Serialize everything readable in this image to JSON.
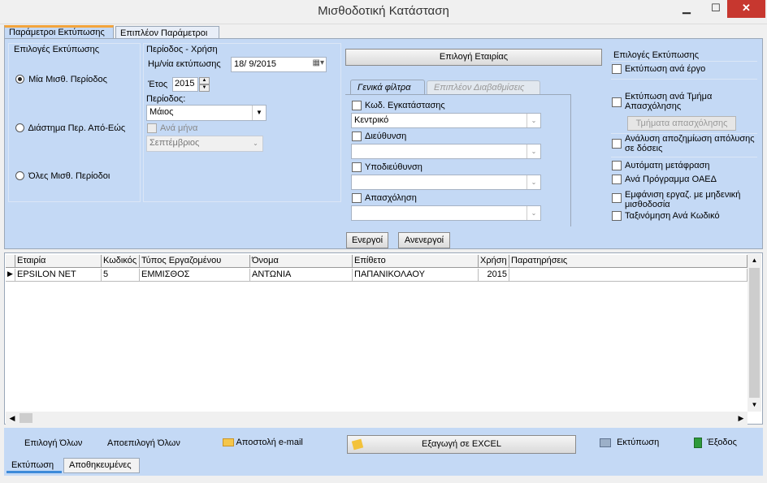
{
  "window": {
    "title": "Μισθοδοτική Κατάσταση",
    "minimize": "▁",
    "maximize": "☐",
    "close": "✕"
  },
  "top_tabs": [
    "Παράμετροι Εκτύπωσης",
    "Επιπλέον Παράμετροι"
  ],
  "print_options_group": {
    "title": "Επιλογές Εκτύπωσης",
    "radios": [
      {
        "label": "Μία Μισθ. Περίοδος",
        "selected": true
      },
      {
        "label": "Διάστημα Περ.  Από-Εώς",
        "selected": false
      },
      {
        "label": "Όλες Μισθ. Περίοδοι",
        "selected": false
      }
    ]
  },
  "period_group": {
    "title": "Περίοδος - Χρήση",
    "date_label": "Ημ/νία εκτύπωσης",
    "date_value": "18/  9/2015",
    "year_label": "Έτος",
    "year_value": "2015",
    "period_label": "Περίοδος:",
    "period_value": "Μάιος",
    "per_month_label": "Ανά μήνα",
    "month_value": "Σεπτέμβριος"
  },
  "company_button": "Επιλογή Εταιρίας",
  "filter_tabs": [
    "Γενικά φίλτρα",
    "Επιπλέον Διαβαθμίσεις"
  ],
  "filters": [
    {
      "label": "Κωδ. Εγκατάστασης",
      "value": "Κεντρικό"
    },
    {
      "label": "Διεύθυνση",
      "value": ""
    },
    {
      "label": "Υποδιεύθυνση",
      "value": ""
    },
    {
      "label": "Απασχόληση",
      "value": ""
    }
  ],
  "active_button": "Ενεργοί",
  "inactive_button": "Ανενεργοί",
  "right_options": {
    "title": "Επιλογές Εκτύπωσης",
    "items": [
      "Εκτύπωση ανά έργο",
      "Εκτύπωση ανά Τμήμα Απασχόλησης",
      "Ανάλυση αποζημίωση απόλυσης σε δόσεις",
      "Αυτόματη μετάφραση",
      "Ανά Πρόγραμμα ΟΑΕΔ",
      "Εμφάνιση εργαζ. με μηδενική μισθοδοσία",
      "Ταξινόμηση Ανά Κωδικό"
    ],
    "departments_button": "Τμήματα απασχόλησης"
  },
  "grid": {
    "columns": [
      "Εταιρία",
      "Κωδικός",
      "Τύπος Εργαζομένου",
      "Όνομα",
      "Επίθετο",
      "Χρήση",
      "Παρατηρήσεις"
    ],
    "rows": [
      [
        "EPSILON NET",
        "5",
        "ΕΜΜΙΣΘΟΣ",
        "ΑΝΤΩΝΙΑ",
        "ΠΑΠΑΝΙΚΟΛΑΟΥ",
        "2015",
        ""
      ]
    ]
  },
  "bottom_actions": {
    "select_all": "Επιλογή Όλων",
    "deselect_all": "Αποεπιλογή Όλων",
    "send_email": "Αποστολή e-mail",
    "export_excel": "Εξαγωγή σε EXCEL",
    "print": "Εκτύπωση",
    "exit": "Έξοδος"
  },
  "bottom_tabs": [
    "Εκτύπωση",
    "Αποθηκευμένες"
  ]
}
